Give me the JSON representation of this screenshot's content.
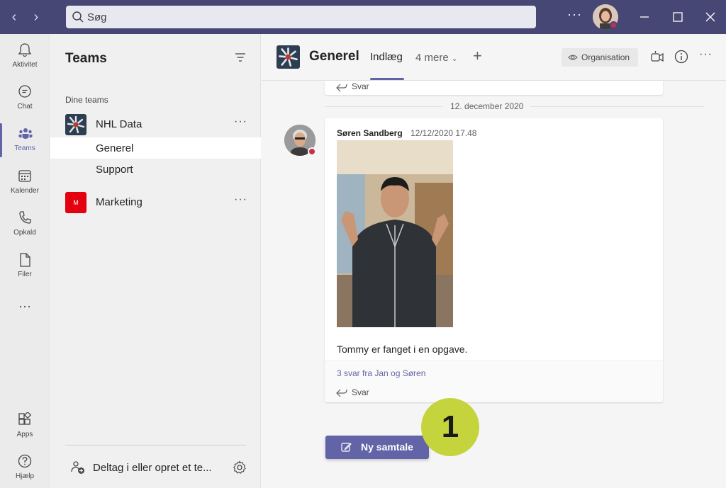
{
  "titlebar": {
    "search_placeholder": "Søg",
    "more_label": "···"
  },
  "rail": {
    "items": [
      {
        "label": "Aktivitet",
        "icon": "bell-icon"
      },
      {
        "label": "Chat",
        "icon": "chat-icon"
      },
      {
        "label": "Teams",
        "icon": "teams-icon",
        "active": true
      },
      {
        "label": "Kalender",
        "icon": "calendar-icon"
      },
      {
        "label": "Opkald",
        "icon": "phone-icon"
      },
      {
        "label": "Filer",
        "icon": "file-icon"
      }
    ],
    "more_label": "···",
    "apps_label": "Apps",
    "help_label": "Hjælp"
  },
  "teams_panel": {
    "title": "Teams",
    "section_label": "Dine teams",
    "teams": [
      {
        "name": "NHL Data",
        "more": "···",
        "channels": [
          "Generel",
          "Support"
        ]
      },
      {
        "name": "Marketing",
        "more": "···",
        "avatar_text": "M"
      }
    ],
    "join_label": "Deltag i eller opret et te..."
  },
  "main": {
    "channel_title": "Generel",
    "tab_posts": "Indlæg",
    "tab_more": "4 mere",
    "tab_add": "+",
    "org_button": "Organisation",
    "header_more": "···",
    "prev_reply": "Svar",
    "date_divider": "12. december 2020",
    "message": {
      "author": "Søren Sandberg",
      "time": "12/12/2020 17.48",
      "body": "Tommy er fanget i en opgave.",
      "replies_link": "3 svar fra Jan og Søren",
      "reply_label": "Svar"
    },
    "new_conversation": "Ny samtale",
    "step_badge": "1"
  },
  "colors": {
    "titlebar": "#464775",
    "accent": "#6264a7",
    "badge": "#c5d33d",
    "status_busy": "#c4314b"
  }
}
